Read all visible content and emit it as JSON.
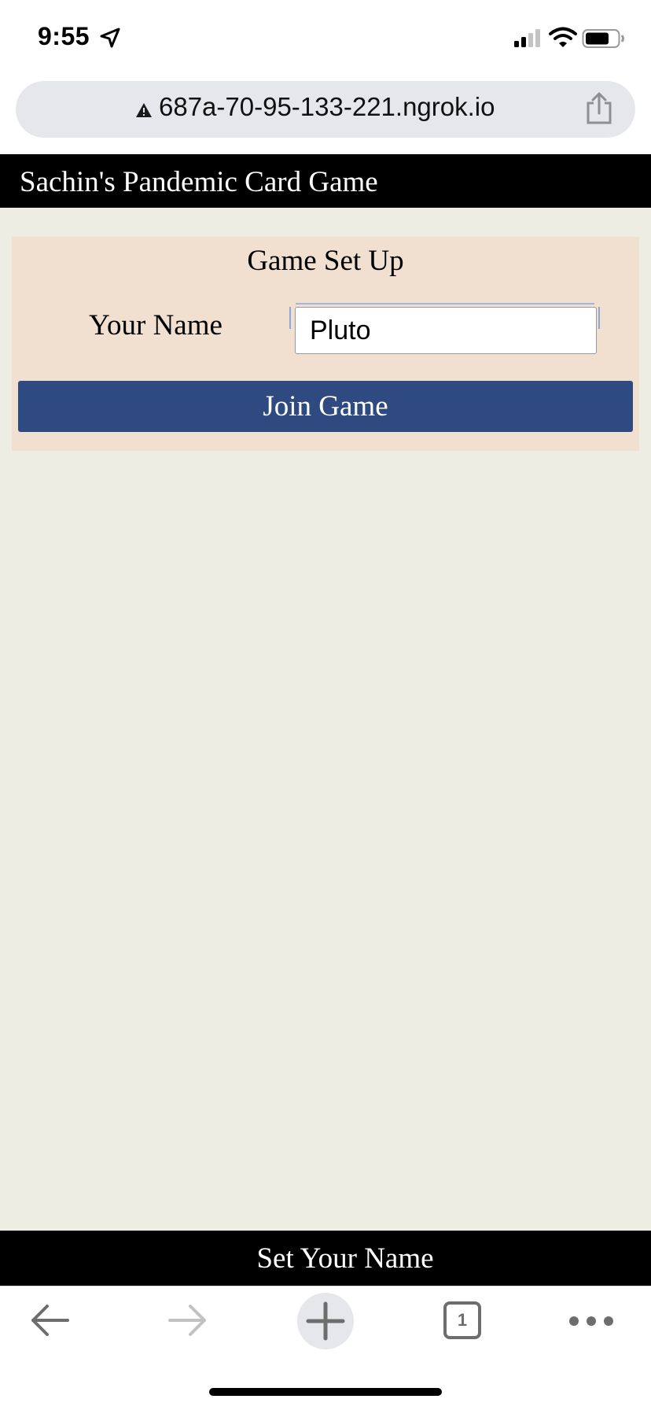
{
  "status_bar": {
    "time": "9:55",
    "icons": [
      "location-arrow-icon",
      "cellular-signal-icon",
      "wifi-icon",
      "battery-icon"
    ]
  },
  "browser": {
    "url": "687a-70-95-133-221.ngrok.io",
    "security_icon": "warning-triangle-icon",
    "tab_count": "1",
    "toolbar_icons": [
      "back-arrow-icon",
      "forward-arrow-icon",
      "plus-icon",
      "tabs-icon",
      "more-dots-icon"
    ]
  },
  "site": {
    "title": "Sachin's Pandemic Card Game"
  },
  "setup": {
    "heading": "Game Set Up",
    "name_label": "Your Name",
    "name_value": "Pluto",
    "join_label": "Join Game"
  },
  "footer": {
    "text": "Set Your Name"
  },
  "colors": {
    "page_background": "#eeede3",
    "panel_background": "#f1e0d0",
    "header_background": "#000000",
    "button_background": "#2e4a81",
    "address_bar": "#e6e7eb"
  }
}
